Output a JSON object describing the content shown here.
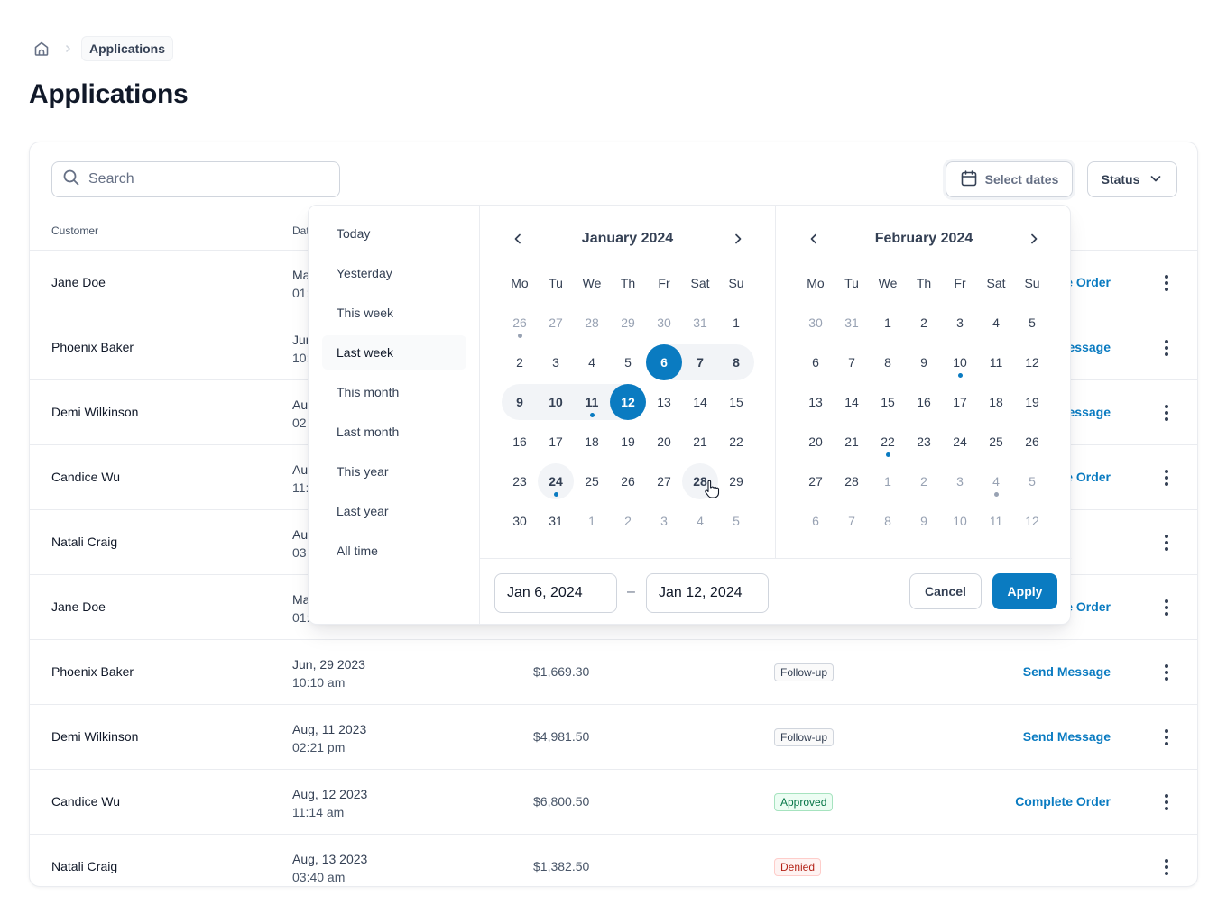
{
  "breadcrumb": {
    "home_icon": "home-icon",
    "separator_icon": "chevron-right-icon",
    "current": "Applications"
  },
  "page": {
    "title": "Applications"
  },
  "toolbar": {
    "search_placeholder": "Search",
    "select_dates_label": "Select dates",
    "status_label": "Status"
  },
  "table": {
    "columns": [
      "Customer",
      "Dat"
    ],
    "rows": [
      {
        "customer": "Jane Doe",
        "date": "Ma",
        "time": "01:",
        "amount": "",
        "badge": "",
        "action": "e Order"
      },
      {
        "customer": "Phoenix Baker",
        "date": "Jun",
        "time": "10:",
        "amount": "",
        "badge": "",
        "action": "lessage"
      },
      {
        "customer": "Demi Wilkinson",
        "date": "Au",
        "time": "02",
        "amount": "",
        "badge": "",
        "action": "essage"
      },
      {
        "customer": "Candice Wu",
        "date": "Au",
        "time": "11:",
        "amount": "",
        "badge": "",
        "action": "e Order"
      },
      {
        "customer": "Natali Craig",
        "date": "Au",
        "time": "03",
        "amount": "",
        "badge": "",
        "action": ""
      },
      {
        "customer": "Jane Doe",
        "date": "Ma",
        "time": "01:",
        "amount": "",
        "badge": "",
        "action": "e Order"
      },
      {
        "customer": "Phoenix Baker",
        "date": "Jun, 29 2023",
        "time": "10:10 am",
        "amount": "$1,669.30",
        "badge": "Follow-up",
        "badge_type": "neutral",
        "action": "Send Message"
      },
      {
        "customer": "Demi Wilkinson",
        "date": "Aug, 11 2023",
        "time": "02:21 pm",
        "amount": "$4,981.50",
        "badge": "Follow-up",
        "badge_type": "neutral",
        "action": "Send Message"
      },
      {
        "customer": "Candice Wu",
        "date": "Aug, 12 2023",
        "time": "11:14 am",
        "amount": "$6,800.50",
        "badge": "Approved",
        "badge_type": "approved",
        "action": "Complete Order"
      },
      {
        "customer": "Natali Craig",
        "date": "Aug, 13 2023",
        "time": "03:40 am",
        "amount": "$1,382.50",
        "badge": "Denied",
        "badge_type": "denied",
        "action": ""
      }
    ]
  },
  "datepicker": {
    "presets": [
      "Today",
      "Yesterday",
      "This week",
      "Last week",
      "This month",
      "Last month",
      "This year",
      "Last year",
      "All time"
    ],
    "active_preset": "Last week",
    "weekdays": [
      "Mo",
      "Tu",
      "We",
      "Th",
      "Fr",
      "Sat",
      "Su"
    ],
    "months": [
      {
        "title": "January 2024",
        "days": [
          [
            "26",
            "27",
            "28",
            "29",
            "30",
            "31",
            "1"
          ],
          [
            "2",
            "3",
            "4",
            "5",
            "6",
            "7",
            "8"
          ],
          [
            "9",
            "10",
            "11",
            "12",
            "13",
            "14",
            "15"
          ],
          [
            "16",
            "17",
            "18",
            "19",
            "20",
            "21",
            "22"
          ],
          [
            "23",
            "24",
            "25",
            "26",
            "27",
            "28",
            "29"
          ],
          [
            "30",
            "31",
            "1",
            "2",
            "3",
            "4",
            "5"
          ]
        ]
      },
      {
        "title": "February 2024",
        "days": [
          [
            "30",
            "31",
            "1",
            "2",
            "3",
            "4",
            "5"
          ],
          [
            "6",
            "7",
            "8",
            "9",
            "10",
            "11",
            "12"
          ],
          [
            "13",
            "14",
            "15",
            "16",
            "17",
            "18",
            "19"
          ],
          [
            "20",
            "21",
            "22",
            "23",
            "24",
            "25",
            "26"
          ],
          [
            "27",
            "28",
            "1",
            "2",
            "3",
            "4",
            "5"
          ],
          [
            "6",
            "7",
            "8",
            "9",
            "10",
            "11",
            "12"
          ]
        ]
      }
    ],
    "start_input": "Jan 6, 2024",
    "end_input": "Jan 12, 2024",
    "range_separator": "–",
    "cancel_label": "Cancel",
    "apply_label": "Apply"
  },
  "colors": {
    "accent": "#0A7BC1",
    "border": "#D0D5DD",
    "muted_text": "#98A2B3"
  }
}
